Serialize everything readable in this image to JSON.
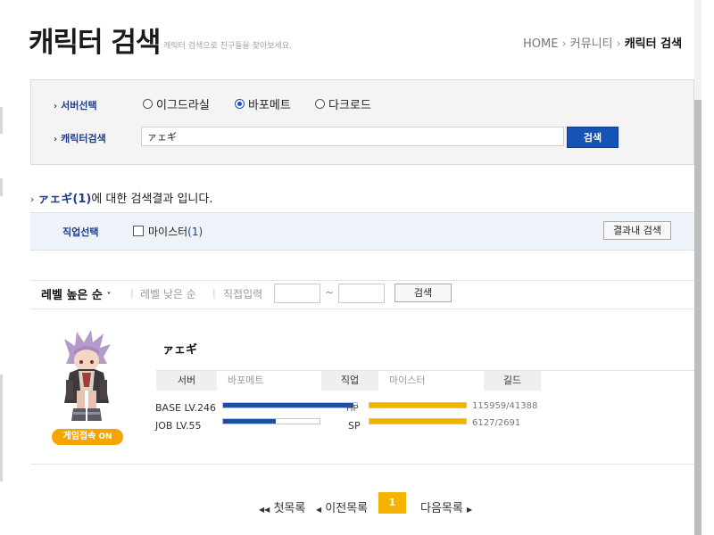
{
  "header": {
    "title": "캐릭터 검색",
    "subtitle": "캐릭터 검색으로 친구들을 찾아보세요.",
    "breadcrumb": [
      "HOME",
      "커뮤니티",
      "캐릭터 검색"
    ]
  },
  "search": {
    "server_label": "서버선택",
    "servers": [
      "이그드라실",
      "바포메트",
      "다크로드"
    ],
    "selected_server": "바포메트",
    "character_label": "캐릭터검색",
    "query": "ァェギ",
    "button": "검색"
  },
  "result": {
    "keyword": "ァェギ(1)",
    "suffix": "에 대한 검색결과 입니다."
  },
  "job_filter": {
    "label": "직업선택",
    "option": "마이스터",
    "option_count": "(1)",
    "checked": false,
    "search_in_results": "결과내 검색"
  },
  "sort": {
    "active": "레벨 높은 순",
    "alt": "레벨 낮은 순",
    "direct_input": "직접입력",
    "tilde": "~",
    "button": "검색"
  },
  "character": {
    "online_badge": "게임접속",
    "online_state": "ON",
    "name": "ァェギ",
    "server_header": "서버",
    "server": "바포메트",
    "job_header": "직업",
    "job": "마이스터",
    "guild_header": "길드",
    "guild": "",
    "base_lv": "BASE LV.246",
    "job_lv": "JOB LV.55",
    "base_exp_fraction": 0.97,
    "job_exp_fraction": 0.55,
    "hp_label": "HP",
    "hp_value": "115959/41388",
    "hp_fraction": 1.0,
    "sp_label": "SP",
    "sp_value": "6127/2691",
    "sp_fraction": 1.0
  },
  "pagination": {
    "first": "첫목록",
    "prev": "이전목록",
    "current": "1",
    "next": "다음목록"
  },
  "colors": {
    "accent_blue": "#1553b6",
    "badge_orange": "#f6a400",
    "bar_yellow": "#f0b400"
  }
}
